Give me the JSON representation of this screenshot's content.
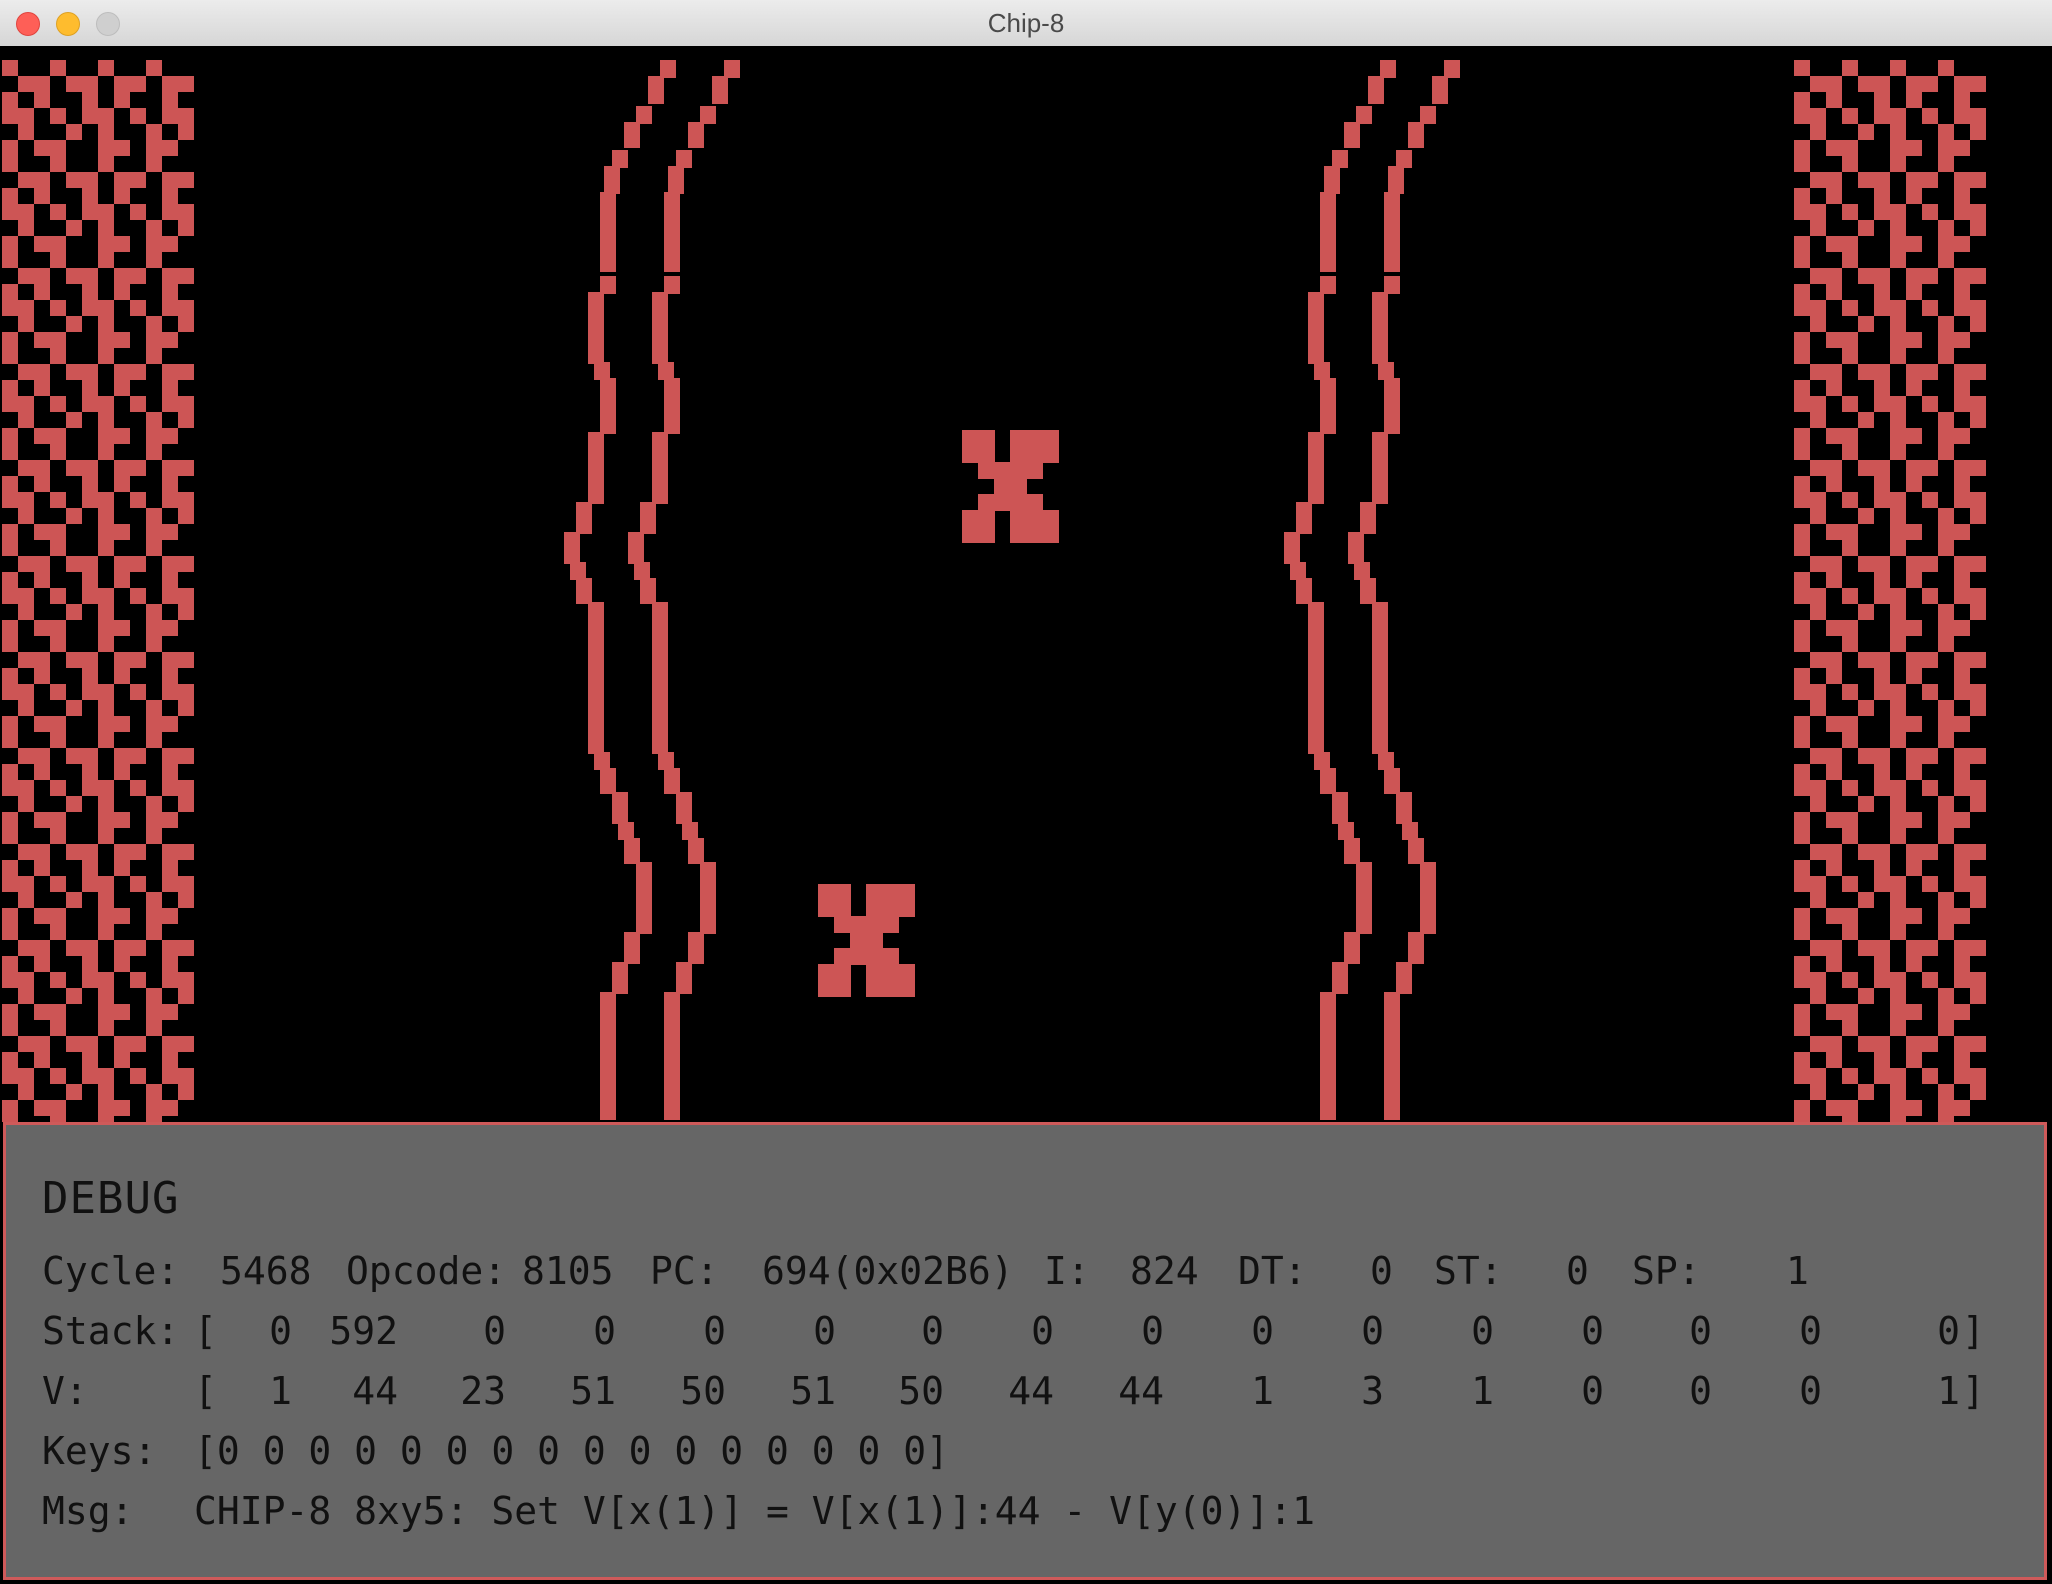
{
  "window": {
    "title": "Chip-8"
  },
  "screen": {
    "pixel_color": "#cd5555",
    "background_color": "#000000",
    "cars": [
      "player-car",
      "enemy-car"
    ]
  },
  "debug": {
    "heading": "DEBUG",
    "cycle_label": "Cycle:",
    "cycle": "5468",
    "opcode_label": "Opcode:",
    "opcode": "8105",
    "pc_label": "PC:",
    "pc": "694(0x02B6)",
    "i_label": "I:",
    "i": "824",
    "dt_label": "DT:",
    "dt": "0",
    "st_label": "ST:",
    "st": "0",
    "sp_label": "SP:",
    "sp": "1",
    "stack_label": "Stack:",
    "stack": [
      "0",
      "592",
      "0",
      "0",
      "0",
      "0",
      "0",
      "0",
      "0",
      "0",
      "0",
      "0",
      "0",
      "0",
      "0",
      "0"
    ],
    "v_label": "V:",
    "v": [
      "1",
      "44",
      "23",
      "51",
      "50",
      "51",
      "50",
      "44",
      "44",
      "1",
      "3",
      "1",
      "0",
      "0",
      "0",
      "1"
    ],
    "open_bracket": "[",
    "close_bracket": "]",
    "keys_label": "Keys:",
    "keys": "[0 0 0 0 0 0 0 0 0 0 0 0 0 0 0 0]",
    "msg_label": "Msg:",
    "msg": "CHIP-8 8xy5: Set V[x(1)] = V[x(1)]:44 - V[y(0)]:1"
  }
}
